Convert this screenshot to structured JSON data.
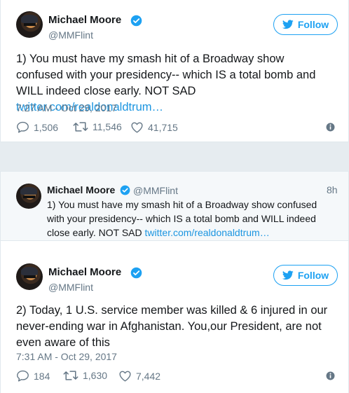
{
  "tweets": [
    {
      "name": "Michael Moore",
      "handle": "@MMFlint",
      "follow_label": "Follow",
      "text": "1) You must have my smash hit of a Broadway show confused with your presidency-- which IS a total bomb and WILL indeed close early. NOT SAD ",
      "link": "twitter.com/realdonaldtrum…",
      "timestamp": "7:27 AM - Oct 29, 2017",
      "replies": "1,506",
      "retweets": "11,546",
      "likes": "41,715"
    },
    {
      "name": "Michael Moore",
      "handle": "@MMFlint",
      "follow_label": "Follow",
      "text": "2) Today, 1 U.S. service member was killed & 6 injured in our never-ending war in Afghanistan. You,our President, are not even aware of this",
      "timestamp": "7:31 AM - Oct 29, 2017",
      "replies": "184",
      "retweets": "1,630",
      "likes": "7,442"
    }
  ],
  "quoted": {
    "name": "Michael Moore",
    "handle": "@MMFlint",
    "age": "8h",
    "text": "1) You must have my smash hit of a Broadway show confused with your presidency-- which IS a total bomb and WILL indeed close early. NOT SAD ",
    "link": "twitter.com/realdonaldtrum…"
  },
  "colors": {
    "accent": "#1da1f2",
    "verified": "#1da1f2",
    "link": "#1b95e0",
    "muted": "#657786"
  },
  "icons": [
    "twitter-bird-icon",
    "verified-badge-icon",
    "reply-icon",
    "retweet-icon",
    "like-icon",
    "info-icon"
  ]
}
